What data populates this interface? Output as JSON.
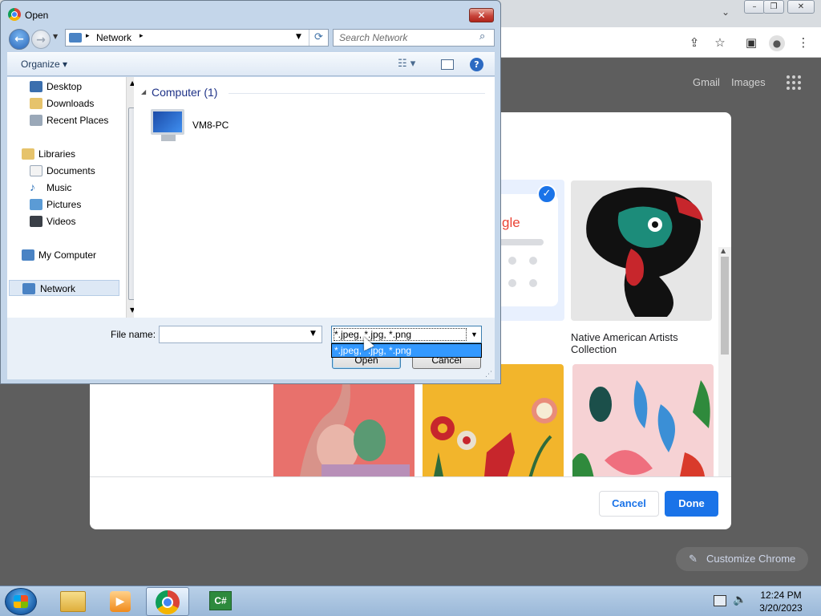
{
  "browser": {
    "links": [
      "Gmail",
      "Images"
    ],
    "customize_label": "Customize Chrome"
  },
  "modal": {
    "captions": [
      "Native American Artists",
      "Collection"
    ],
    "logo_text": "gle",
    "cancel_label": "Cancel",
    "done_label": "Done"
  },
  "dialog": {
    "title": "Open",
    "close_glyph": "✕",
    "address": "Network",
    "search_placeholder": "Search Network",
    "organize_label": "Organize",
    "nav_items": [
      {
        "label": "Desktop",
        "icon": "desktop-icon"
      },
      {
        "label": "Downloads",
        "icon": "downloads-icon"
      },
      {
        "label": "Recent Places",
        "icon": "recent-places-icon"
      },
      {
        "label": "Libraries",
        "icon": "libraries-icon"
      },
      {
        "label": "Documents",
        "icon": "documents-icon"
      },
      {
        "label": "Music",
        "icon": "music-icon"
      },
      {
        "label": "Pictures",
        "icon": "pictures-icon"
      },
      {
        "label": "Videos",
        "icon": "videos-icon"
      },
      {
        "label": "My Computer",
        "icon": "computer-icon"
      },
      {
        "label": "Network",
        "icon": "network-icon",
        "selected": true
      }
    ],
    "group_header": "Computer (1)",
    "computer_name": "VM8-PC",
    "file_name_label": "File name:",
    "file_name_value": "",
    "filter_selected": "*.jpeg, *.jpg, *.png",
    "filter_options": [
      "*.jpeg, *.jpg, *.png"
    ],
    "open_label": "Open",
    "cancel_label": "Cancel"
  },
  "taskbar": {
    "time": "12:24 PM",
    "date": "3/20/2023"
  },
  "colors": {
    "accent_blue": "#1a73e8",
    "dialog_frame": "#c4d6ea",
    "dropdown_highlight": "#3399ff"
  }
}
